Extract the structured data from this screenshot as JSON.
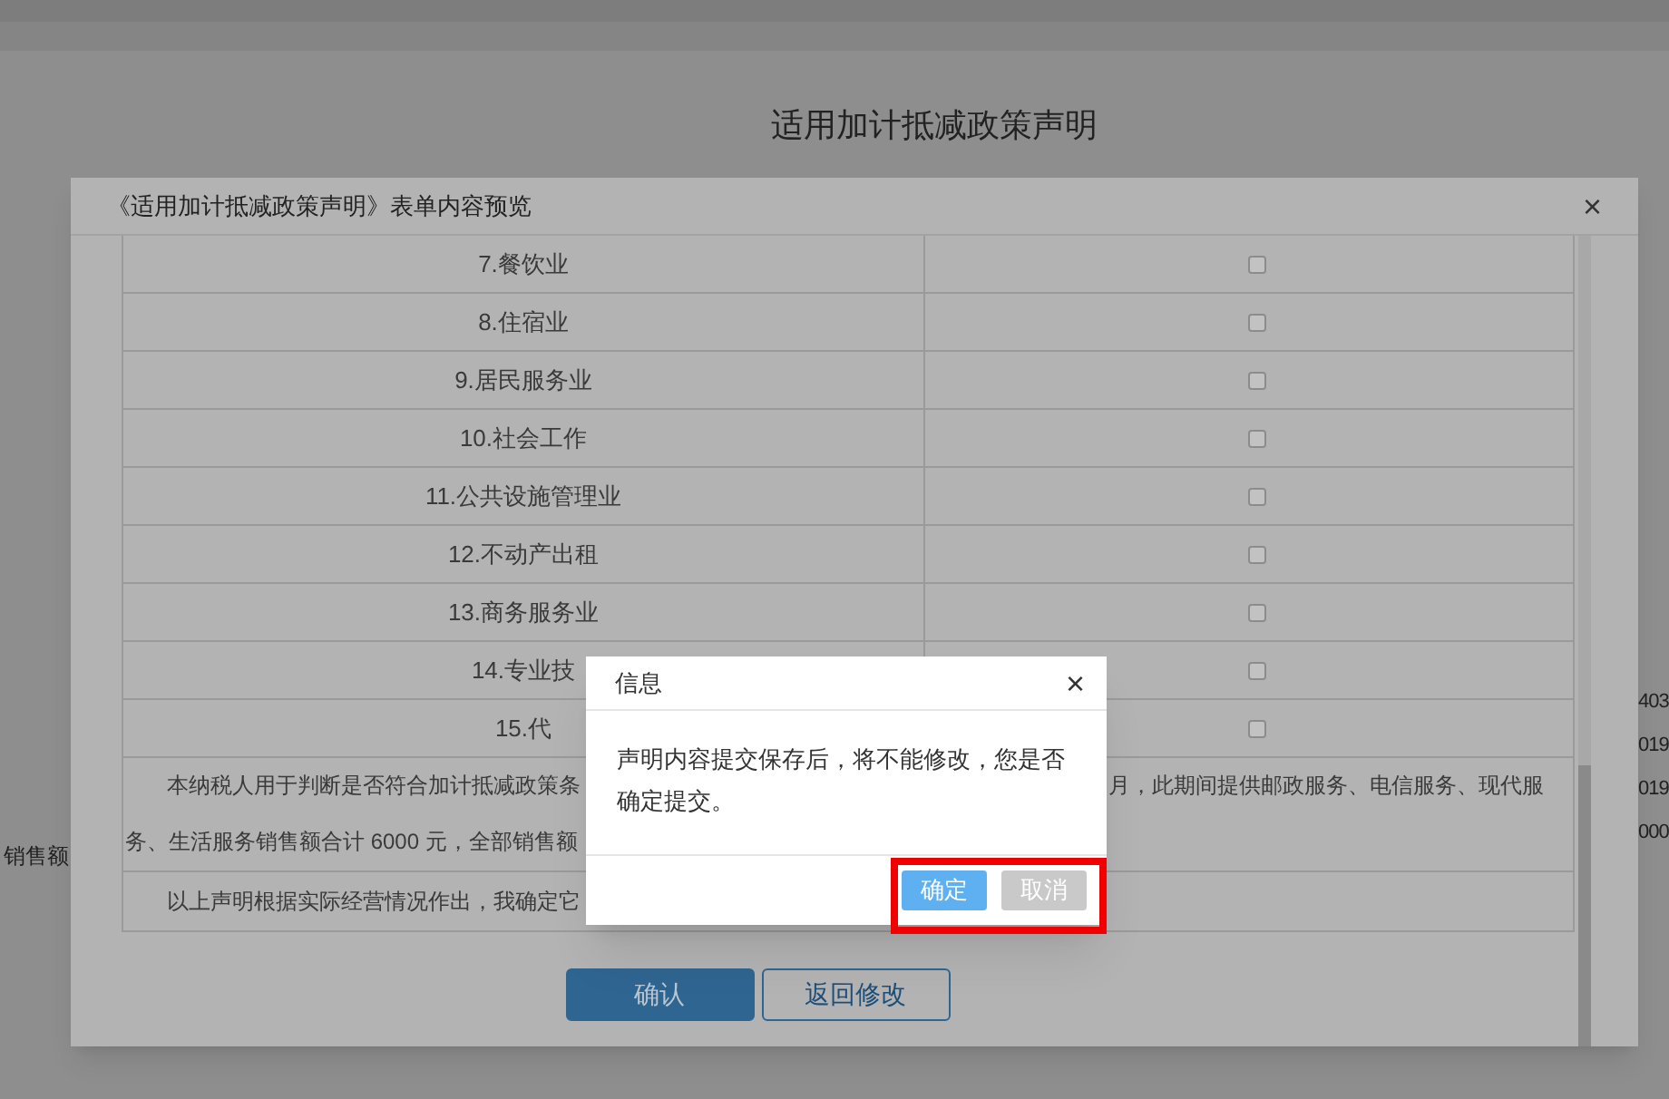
{
  "page": {
    "title": "适用加计抵减政策声明",
    "left_fragments": [
      "销售额"
    ],
    "right_fragments": [
      "403",
      "019",
      "019",
      "000"
    ]
  },
  "preview": {
    "title": "《适用加计抵减政策声明》表单内容预览",
    "close": "×",
    "rows": [
      {
        "label": "7.餐饮业",
        "checked": false
      },
      {
        "label": "8.住宿业",
        "checked": false
      },
      {
        "label": "9.居民服务业",
        "checked": false
      },
      {
        "label": "10.社会工作",
        "checked": false
      },
      {
        "label": "11.公共设施管理业",
        "checked": false
      },
      {
        "label": "12.不动产出租",
        "checked": false
      },
      {
        "label": "13.商务服务业",
        "checked": false
      },
      {
        "label": "14.专业技",
        "checked": false
      },
      {
        "label": "15.代",
        "checked": false
      }
    ],
    "paragraph": {
      "left_lines": [
        "本纳税人用于判断是否符合加计抵减政策条",
        "务、生活服务销售额合计 6000 元，全部销售额"
      ],
      "right_lines": [
        "月，此期间提供邮政服务、电信服务、现代服"
      ]
    },
    "closing": "以上声明根据实际经营情况作出，我确定它",
    "buttons": [
      {
        "label": "确认",
        "kind": "primary"
      },
      {
        "label": "返回修改",
        "kind": "outline"
      }
    ]
  },
  "dialog": {
    "title": "信息",
    "close": "×",
    "message": "声明内容提交保存后，将不能修改，您是否确定提交。",
    "buttons": [
      {
        "label": "确定",
        "kind": "primary"
      },
      {
        "label": "取消",
        "kind": "secondary"
      }
    ],
    "highlight": true
  }
}
